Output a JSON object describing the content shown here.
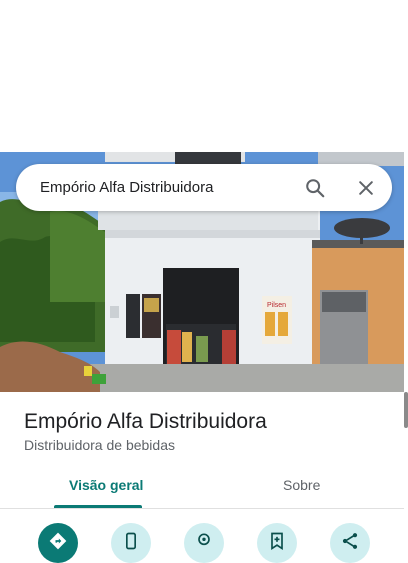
{
  "search": {
    "query": "Empório Alfa Distribuidora"
  },
  "place": {
    "name": "Empório Alfa Distribuidora",
    "category": "Distribuidora de bebidas"
  },
  "tabs": [
    {
      "label": "Visão geral",
      "active": true
    },
    {
      "label": "Sobre",
      "active": false
    }
  ],
  "actions": [
    {
      "icon": "directions-icon"
    },
    {
      "icon": "phone-icon"
    },
    {
      "icon": "location-icon"
    },
    {
      "icon": "save-icon"
    },
    {
      "icon": "share-icon"
    }
  ],
  "photo": {
    "sign_text": "Pilsen"
  },
  "colors": {
    "accent": "#0b7a75",
    "accent_light": "#cfeef0"
  }
}
